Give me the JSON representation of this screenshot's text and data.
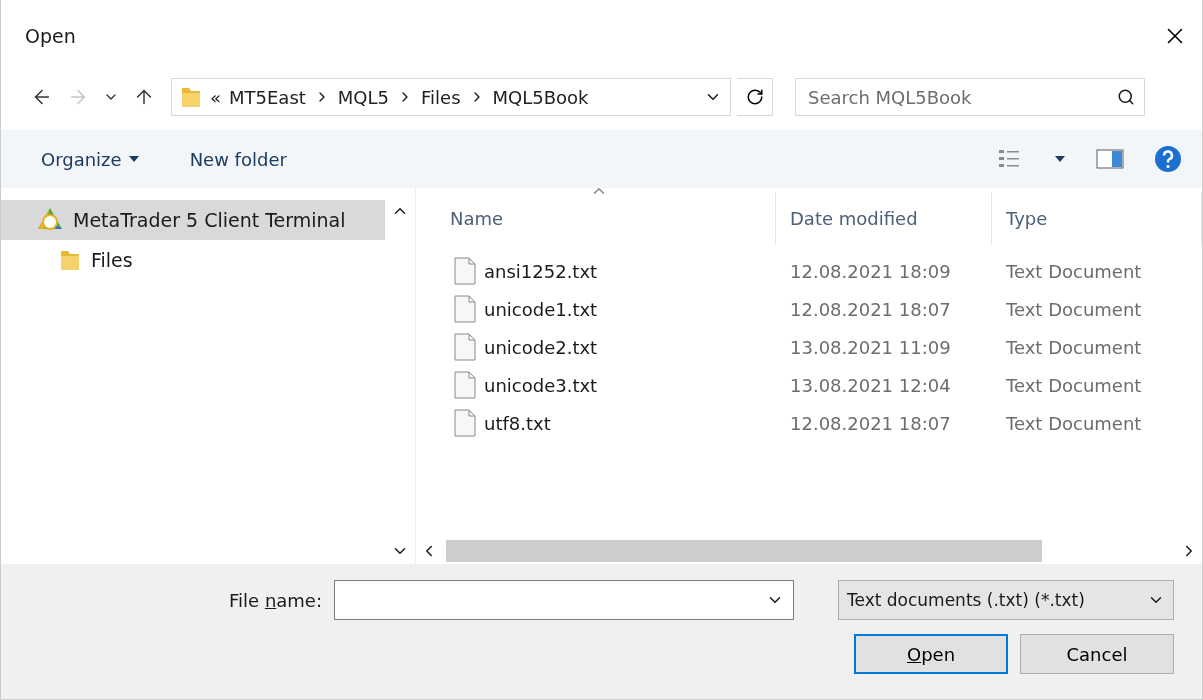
{
  "window": {
    "title": "Open"
  },
  "navigation": {
    "back_disabled": false,
    "forward_disabled": true
  },
  "address": {
    "overflow_mark": "«",
    "path": [
      "MT5East",
      "MQL5",
      "Files",
      "MQL5Book"
    ]
  },
  "search": {
    "placeholder": "Search MQL5Book"
  },
  "toolbar": {
    "organize": "Organize",
    "new_folder": "New folder"
  },
  "sidebar": {
    "items": [
      {
        "label": "MetaTrader 5 Client Terminal",
        "kind": "app",
        "selected": true,
        "children": [
          {
            "label": "Files",
            "kind": "folder",
            "selected": false
          }
        ]
      }
    ]
  },
  "table": {
    "columns": [
      {
        "label": "Name",
        "sorted": true
      },
      {
        "label": "Date modified",
        "sorted": false
      },
      {
        "label": "Type",
        "sorted": false
      }
    ],
    "rows": [
      {
        "name": "ansi1252.txt",
        "date": "12.08.2021 18:09",
        "type": "Text Document",
        "selected": false
      },
      {
        "name": "unicode1.txt",
        "date": "12.08.2021 18:07",
        "type": "Text Document",
        "selected": false
      },
      {
        "name": "unicode2.txt",
        "date": "13.08.2021 11:09",
        "type": "Text Document",
        "selected": false
      },
      {
        "name": "unicode3.txt",
        "date": "13.08.2021 12:04",
        "type": "Text Document",
        "selected": false
      },
      {
        "name": "utf8.txt",
        "date": "12.08.2021 18:07",
        "type": "Text Document",
        "selected": false
      }
    ]
  },
  "file_name": {
    "label_parts": [
      {
        "text": "File ",
        "underlined": false
      },
      {
        "text": "n",
        "underlined": true
      },
      {
        "text": "ame:",
        "underlined": false
      }
    ]
  },
  "file_type": {
    "value": "Text documents (.txt) (*.txt)"
  },
  "buttons": [
    {
      "label_parts": [
        {
          "text": "O",
          "underlined": true
        },
        {
          "text": "pen",
          "underlined": false
        }
      ],
      "kind": "default"
    },
    {
      "label_parts": [
        {
          "text": "Cancel",
          "underlined": false
        }
      ],
      "kind": "normal"
    }
  ]
}
